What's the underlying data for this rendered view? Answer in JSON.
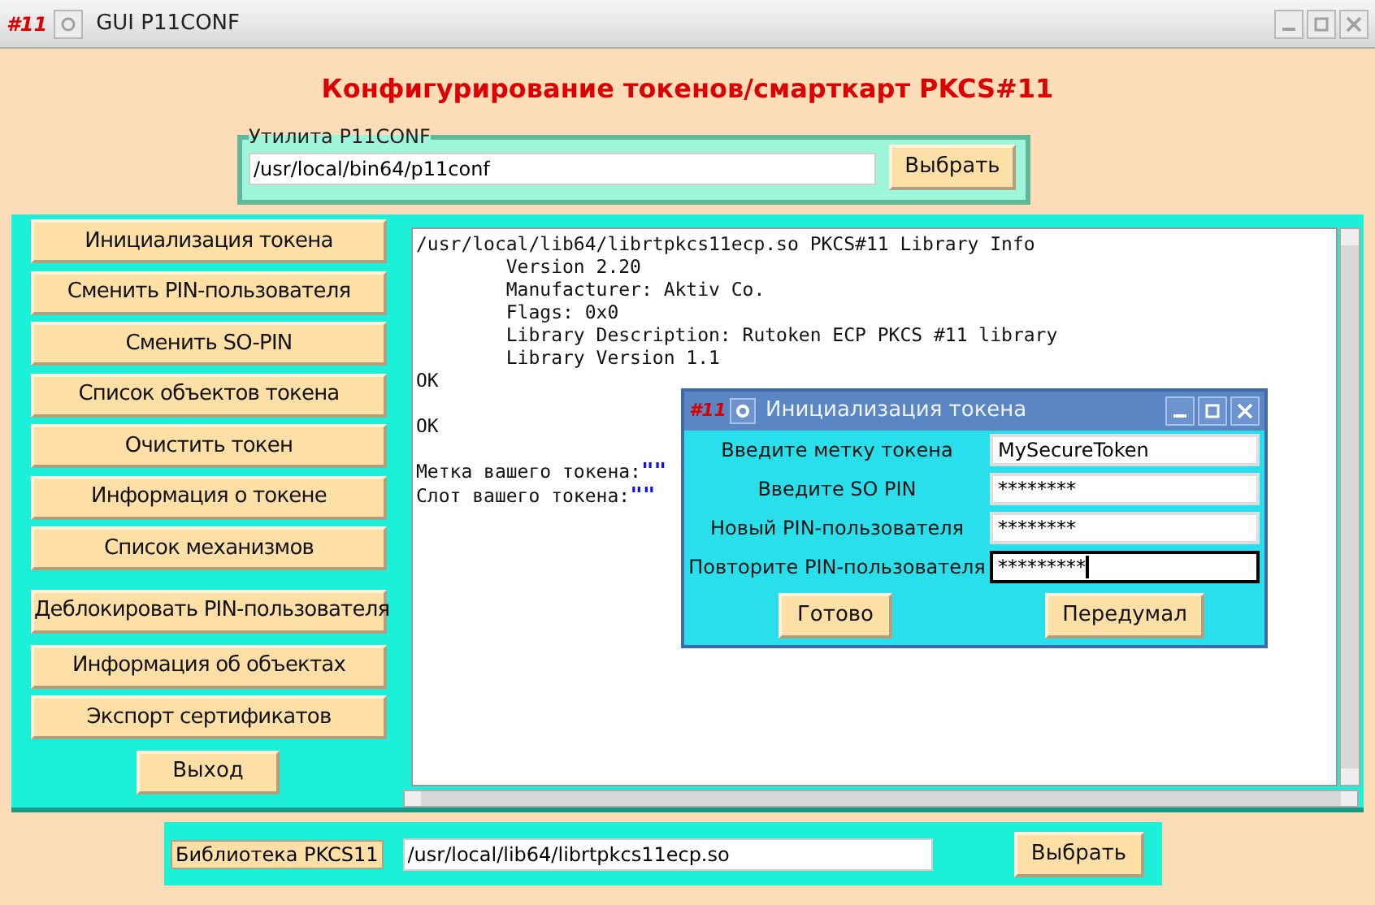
{
  "window": {
    "app_badge": "#11",
    "title": "GUI P11CONF"
  },
  "heading": "Конфигурирование токенов/смарткарт PKCS#11",
  "utility": {
    "legend": "Утилита P11CONF",
    "value": "/usr/local/bin64/p11conf",
    "button": "Выбрать"
  },
  "actions": [
    {
      "label": "Инициализация токена"
    },
    {
      "label": "Сменить PIN-пользователя"
    },
    {
      "label": "Сменить SO-PIN"
    },
    {
      "label": "Список объектов токена"
    },
    {
      "label": "Очистить токен"
    },
    {
      "label": "Информация о токене"
    },
    {
      "label": "Список механизмов"
    },
    {
      "label": "Деблокировать PIN-пользователя"
    },
    {
      "label": "Информация об объектах"
    },
    {
      "label": "Экспорт сертификатов"
    }
  ],
  "exit_button": "Выход",
  "output": [
    {
      "kind": "line",
      "text": "/usr/local/lib64/librtpkcs11ecp.so PKCS#11 Library Info"
    },
    {
      "kind": "line",
      "text": "        Version 2.20"
    },
    {
      "kind": "line",
      "text": "        Manufacturer: Aktiv Co."
    },
    {
      "kind": "line",
      "text": "        Flags: 0x0"
    },
    {
      "kind": "line",
      "text": "        Library Description: Rutoken ECP PKCS #11 library"
    },
    {
      "kind": "line",
      "text": "        Library Version 1.1"
    },
    {
      "kind": "line",
      "text": "OK"
    },
    {
      "kind": "blank"
    },
    {
      "kind": "line",
      "text": "OK"
    },
    {
      "kind": "blank"
    },
    {
      "kind": "line",
      "text": "Метка вашего токена:",
      "value": "\"\""
    },
    {
      "kind": "line",
      "text": "Слот вашего токена:",
      "value": "\"\""
    }
  ],
  "dialog": {
    "app_badge": "#11",
    "title": "Инициализация токена",
    "fields": [
      {
        "label": "Введите метку токена",
        "value": "MySecureToken",
        "focused": false
      },
      {
        "label": "Введите SO PIN",
        "value": "********",
        "focused": false
      },
      {
        "label": "Новый PIN-пользователя",
        "value": "********",
        "focused": false
      },
      {
        "label": "Повторите PIN-пользователя",
        "value": "*********",
        "focused": true
      }
    ],
    "buttons": [
      "Готово",
      "Передумал"
    ]
  },
  "library": {
    "label": "Библиотека PKCS11",
    "value": "/usr/local/lib64/librtpkcs11ecp.so",
    "button": "Выбрать"
  }
}
